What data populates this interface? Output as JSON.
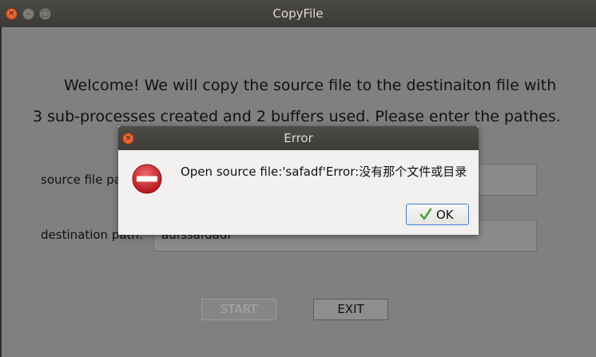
{
  "main_window": {
    "title": "CopyFile",
    "welcome_line1": "Welcome! We will copy the source file to the destinaiton file with",
    "welcome_line2": "3 sub-processes created and 2 buffers used. Please enter the pathes.",
    "source_label": "source file pa",
    "source_value": "",
    "destination_label": "destination path:",
    "destination_value": "adfssafdadf",
    "start_label": "START",
    "exit_label": "EXIT",
    "colors": {
      "titlebar": "#3c3b37",
      "client": "#808080",
      "close_button": "#e2572b"
    }
  },
  "dialog": {
    "title": "Error",
    "message": "Open source file:'safadf'Error:没有那个文件或目录",
    "icon": "error-icon",
    "ok_label": "OK",
    "colors": {
      "background": "#f2f1f0",
      "error_icon": "#c4161c",
      "ok_border": "#3f7fce",
      "check": "#4ea23a"
    }
  }
}
